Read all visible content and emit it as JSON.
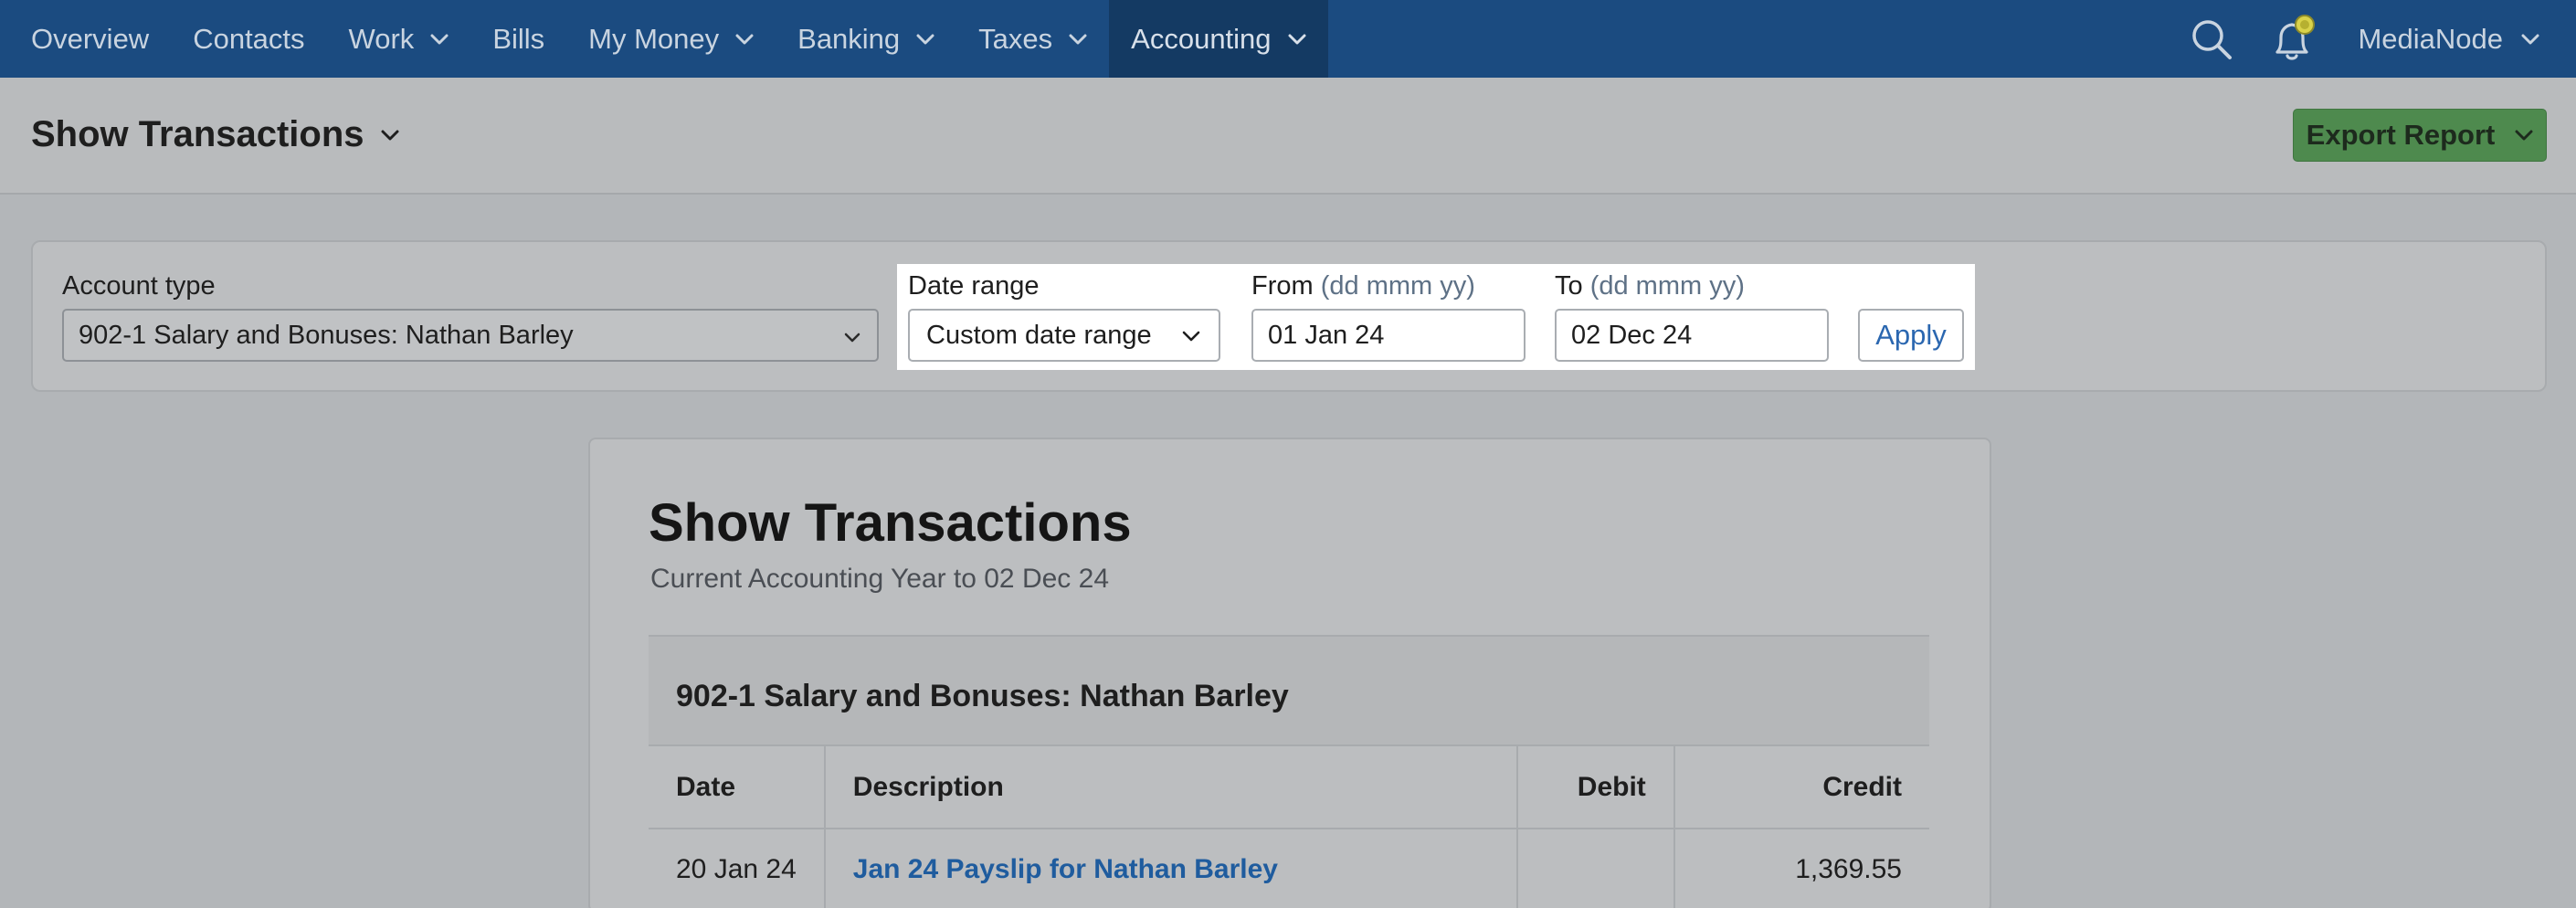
{
  "nav": {
    "items": [
      {
        "label": "Overview",
        "dropdown": false
      },
      {
        "label": "Contacts",
        "dropdown": false
      },
      {
        "label": "Work",
        "dropdown": true
      },
      {
        "label": "Bills",
        "dropdown": false
      },
      {
        "label": "My Money",
        "dropdown": true
      },
      {
        "label": "Banking",
        "dropdown": true
      },
      {
        "label": "Taxes",
        "dropdown": true
      },
      {
        "label": "Accounting",
        "dropdown": true,
        "active": true
      }
    ],
    "user": "MediaNode",
    "icons": [
      "search-icon",
      "bell-icon"
    ]
  },
  "page": {
    "title": "Show Transactions",
    "export_label": "Export Report"
  },
  "filters": {
    "account_type_label": "Account type",
    "account_type_value": "902-1 Salary and Bonuses: Nathan Barley",
    "date_range_label": "Date range",
    "date_range_value": "Custom date range",
    "from_label": "From",
    "from_hint": "(dd mmm yy)",
    "from_value": "01 Jan 24",
    "to_label": "To",
    "to_hint": "(dd mmm yy)",
    "to_value": "02 Dec 24",
    "apply_label": "Apply"
  },
  "report": {
    "title": "Show Transactions",
    "subtitle": "Current Accounting Year to 02 Dec 24",
    "account_heading": "902-1 Salary and Bonuses: Nathan Barley",
    "columns": {
      "date": "Date",
      "description": "Description",
      "debit": "Debit",
      "credit": "Credit"
    },
    "rows": [
      {
        "date": "20 Jan 24",
        "description": "Jan 24 Payslip for Nathan Barley",
        "debit": "",
        "credit": "1,369.55"
      }
    ]
  },
  "colors": {
    "nav_bg": "#1b4b80",
    "nav_active": "#143a63",
    "export_green": "#4e8a4e",
    "link_blue": "#1f5c9e"
  }
}
